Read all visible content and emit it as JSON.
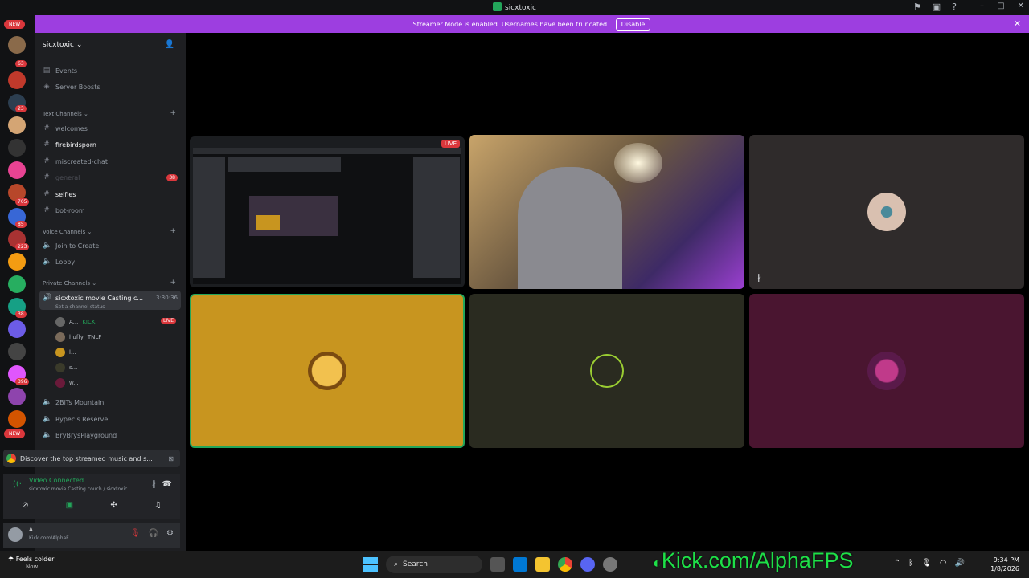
{
  "window": {
    "title": "sicxtoxic"
  },
  "banner": {
    "text": "Streamer Mode is enabled. Usernames have been truncated.",
    "disable_label": "Disable"
  },
  "rail": {
    "new_top": "NEW",
    "new_bottom": "NEW",
    "badges": [
      "63",
      "23",
      "705",
      "85",
      "223",
      "38",
      "396"
    ]
  },
  "server": {
    "name": "sicxtoxic"
  },
  "nav": {
    "events": "Events",
    "boosts": "Server Boosts"
  },
  "text_channels": {
    "label": "Text Channels",
    "items": [
      {
        "name": "welcomes"
      },
      {
        "name": "firebirdsporn"
      },
      {
        "name": "miscreated-chat"
      },
      {
        "name": "general",
        "mentions": "38"
      },
      {
        "name": "selfies"
      },
      {
        "name": "bot-room"
      }
    ]
  },
  "voice_channels": {
    "label": "Voice Channels",
    "items": [
      "Join to Create",
      "Lobby"
    ]
  },
  "private_channels": {
    "label": "Private Channels",
    "active": {
      "name": "sicxtoxic movie Casting c...",
      "timer": "3:30:36",
      "status": "Set a channel status"
    },
    "members": [
      {
        "name": "A...",
        "tag": "KICK",
        "live": "LIVE"
      },
      {
        "name": "huffy",
        "tag": "TNLF"
      },
      {
        "name": "l..."
      },
      {
        "name": "s..."
      },
      {
        "name": "w..."
      }
    ],
    "others": [
      "2BiTs Mountain",
      "Rypec's Reserve",
      "BryBrysPlayground"
    ]
  },
  "notice": {
    "text": "Discover the top streamed music and s..."
  },
  "voice_connection": {
    "status": "Video Connected",
    "channel": "sicxtoxic movie Casting couch / sicxtoxic"
  },
  "user": {
    "name": "A...",
    "status": "Kick.com/AlphaF..."
  },
  "stage": {
    "live_label": "LIVE"
  },
  "taskbar": {
    "weather": "Feels colder",
    "weather_sub": "Now",
    "search": "Search",
    "overlay": "Kick.com/AlphaFPS",
    "time": "9:34 PM",
    "date": "1/8/2026"
  }
}
